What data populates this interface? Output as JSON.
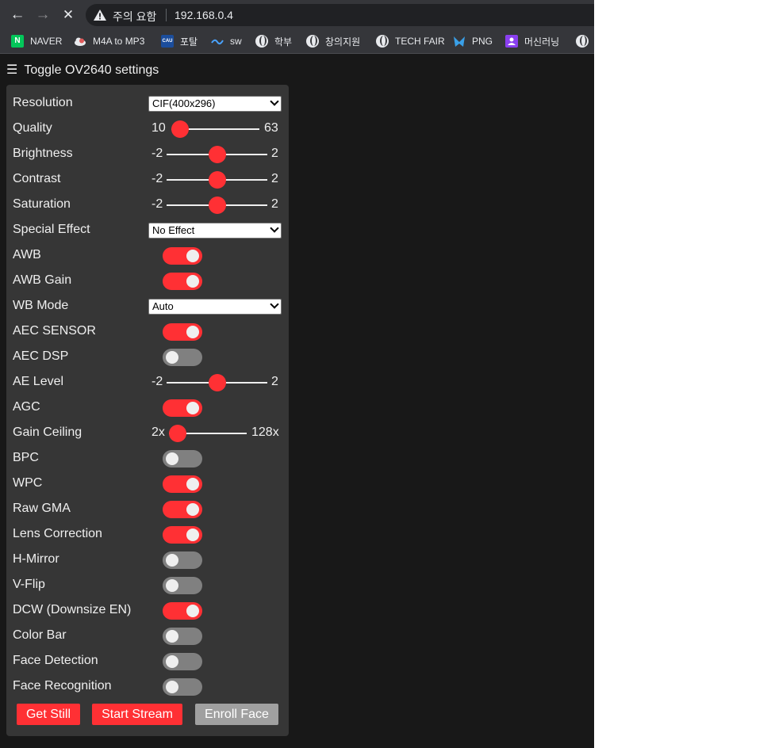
{
  "browser": {
    "security_label": "주의 요함",
    "url": "192.168.0.4",
    "bookmarks": [
      {
        "label": "NAVER",
        "icon": "naver-icon"
      },
      {
        "label": "M4A to MP3",
        "icon": "cloud-icon"
      },
      {
        "label": "포탈",
        "icon": "cau-icon"
      },
      {
        "label": "sw",
        "icon": "sw-icon"
      },
      {
        "label": "학부",
        "icon": "globe-icon"
      },
      {
        "label": "창의지원",
        "icon": "globe-icon"
      },
      {
        "label": "TECH FAIR",
        "icon": "globe-icon"
      },
      {
        "label": "PNG",
        "icon": "png-icon"
      },
      {
        "label": "머신러닝",
        "icon": "ml-icon"
      }
    ],
    "naver_badge": "N",
    "cau_badge": "CAU"
  },
  "settings": {
    "toggle_label": "Toggle OV2640 settings",
    "resolution": {
      "label": "Resolution",
      "value": "CIF(400x296)"
    },
    "quality": {
      "label": "Quality",
      "min": "10",
      "max": "63",
      "level": 0.0
    },
    "brightness": {
      "label": "Brightness",
      "min": "-2",
      "max": "2",
      "level": 0.5
    },
    "contrast": {
      "label": "Contrast",
      "min": "-2",
      "max": "2",
      "level": 0.5
    },
    "saturation": {
      "label": "Saturation",
      "min": "-2",
      "max": "2",
      "level": 0.5
    },
    "special_effect": {
      "label": "Special Effect",
      "value": "No Effect"
    },
    "awb": {
      "label": "AWB",
      "on": true
    },
    "awb_gain": {
      "label": "AWB Gain",
      "on": true
    },
    "wb_mode": {
      "label": "WB Mode",
      "value": "Auto"
    },
    "aec_sensor": {
      "label": "AEC SENSOR",
      "on": true
    },
    "aec_dsp": {
      "label": "AEC DSP",
      "on": false
    },
    "ae_level": {
      "label": "AE Level",
      "min": "-2",
      "max": "2",
      "level": 0.5
    },
    "agc": {
      "label": "AGC",
      "on": true
    },
    "gain_ceiling": {
      "label": "Gain Ceiling",
      "min": "2x",
      "max": "128x",
      "level": 0.0
    },
    "bpc": {
      "label": "BPC",
      "on": false
    },
    "wpc": {
      "label": "WPC",
      "on": true
    },
    "raw_gma": {
      "label": "Raw GMA",
      "on": true
    },
    "lens_correction": {
      "label": "Lens Correction",
      "on": true
    },
    "h_mirror": {
      "label": "H-Mirror",
      "on": false
    },
    "v_flip": {
      "label": "V-Flip",
      "on": false
    },
    "dcw": {
      "label": "DCW (Downsize EN)",
      "on": true
    },
    "color_bar": {
      "label": "Color Bar",
      "on": false
    },
    "face_detection": {
      "label": "Face Detection",
      "on": false
    },
    "face_recognition": {
      "label": "Face Recognition",
      "on": false
    }
  },
  "buttons": {
    "get_still": "Get Still",
    "start_stream": "Start Stream",
    "enroll_face": "Enroll Face"
  },
  "colors": {
    "accent": "#ff3034",
    "disabled_button": "#a0a0a0",
    "switch_off": "#808080"
  }
}
